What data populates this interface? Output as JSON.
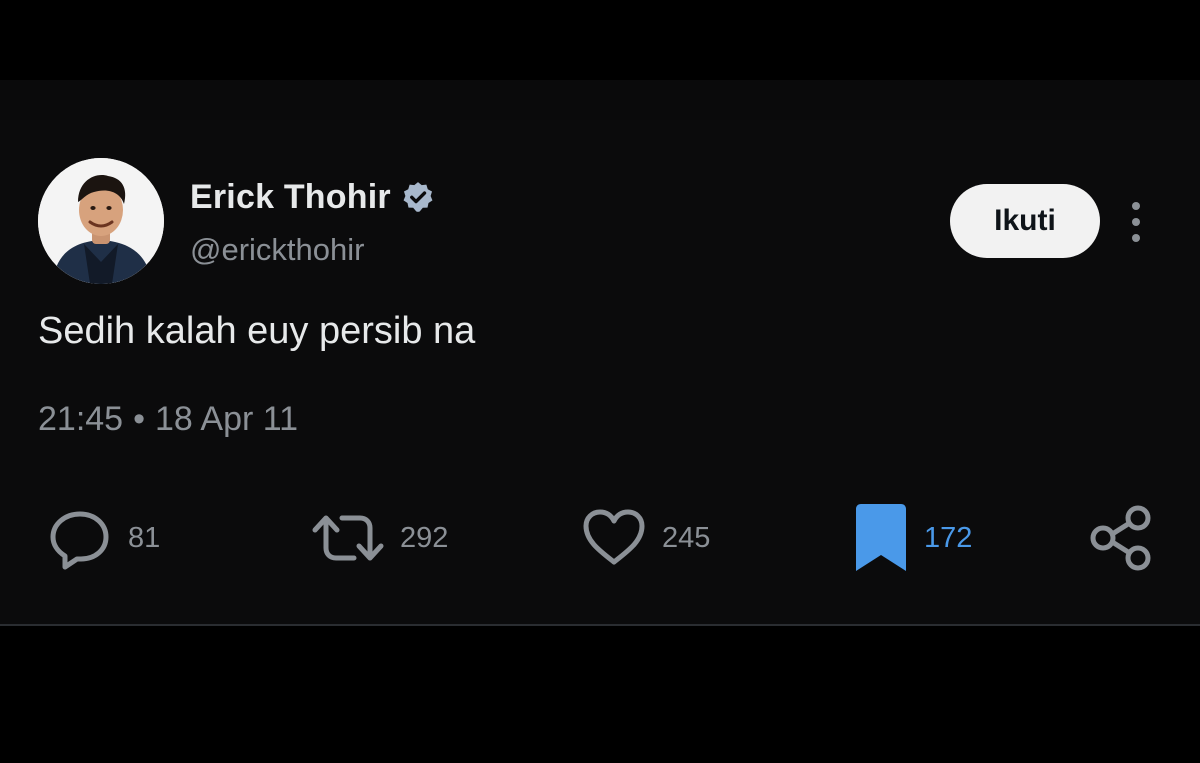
{
  "author": {
    "display_name": "Erick Thohir",
    "handle": "@erickthohir",
    "verified": true
  },
  "follow_button": {
    "label": "Ikuti"
  },
  "tweet": {
    "text": "Sedih kalah euy persib na",
    "time": "21:45",
    "separator": "•",
    "date": "18 Apr 11"
  },
  "actions": {
    "reply": {
      "icon": "reply-icon",
      "count": "81"
    },
    "retweet": {
      "icon": "retweet-icon",
      "count": "292"
    },
    "like": {
      "icon": "heart-icon",
      "count": "245"
    },
    "bookmark": {
      "icon": "bookmark-icon",
      "count": "172",
      "active": true
    },
    "share": {
      "icon": "share-icon"
    }
  },
  "colors": {
    "background": "#000000",
    "text_primary": "#e7e9ea",
    "text_secondary": "#8b9096",
    "accent_blue": "#4a99e9",
    "button_bg": "#f2f2f2"
  }
}
